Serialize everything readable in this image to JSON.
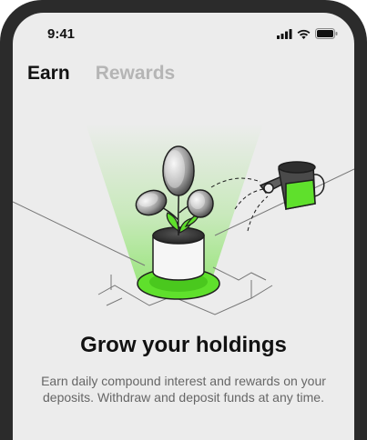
{
  "status_bar": {
    "time": "9:41",
    "icons": [
      "signal-icon",
      "wifi-icon",
      "battery-icon"
    ]
  },
  "tabs": [
    {
      "label": "Earn",
      "active": true
    },
    {
      "label": "Rewards",
      "active": false
    }
  ],
  "hero": {
    "illustration": "plant-growing-coins-watering-can",
    "title": "Grow your holdings",
    "description": "Earn daily compound interest and rewards on your deposits. Withdraw and deposit funds at any time."
  },
  "colors": {
    "accent": "#5fe02c",
    "background": "#ececec",
    "frame": "#2b2b2b",
    "text_primary": "#111111",
    "text_muted": "#666666",
    "tab_inactive": "#b5b5b5"
  }
}
